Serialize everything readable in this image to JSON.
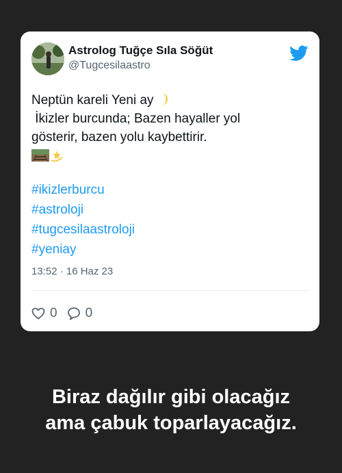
{
  "tweet": {
    "display_name": "Astrolog Tuğçe Sıla Söğüt",
    "handle": "@Tugcesilaastro",
    "text_lines": [
      "Neptün kareli Yeni ay",
      " İkizler burcunda; Bazen hayaller yol",
      "gösterir, bazen yolu kaybettirir."
    ],
    "hashtags": [
      "#ikizlerburcu",
      "#astroloji",
      "#tugcesilaastroloji",
      "#yeniay"
    ],
    "timestamp": "13:52 · 16 Haz 23",
    "likes": "0",
    "replies": "0",
    "icons": {
      "brand": "twitter-bird-icon",
      "moon": "crescent-moon-emoji",
      "railway": "railway-track-emoji",
      "dizzy": "dizzy-emoji",
      "like": "heart-outline-icon",
      "reply": "speech-bubble-icon"
    }
  },
  "caption": {
    "line1": "Biraz dağılır gibi olacağız",
    "line2": "ama çabuk toparlayacağız."
  },
  "colors": {
    "background": "#222222",
    "card": "#ffffff",
    "link": "#1d9bf0",
    "muted": "#536471",
    "text": "#0f1419"
  }
}
